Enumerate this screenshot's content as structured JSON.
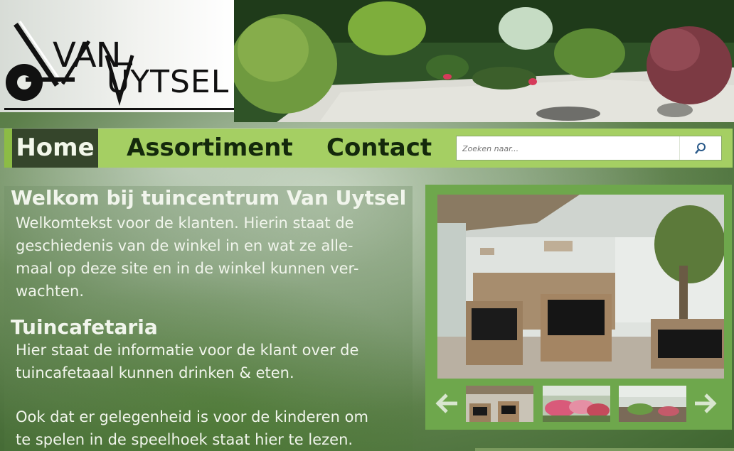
{
  "logo": {
    "line1": "VAN",
    "line2": "UYTSEL"
  },
  "nav": {
    "items": [
      {
        "label": "Home"
      },
      {
        "label": "Assortiment"
      },
      {
        "label": "Contact"
      }
    ],
    "search": {
      "placeholder": "Zoeken naar..."
    }
  },
  "main": {
    "title": "Welkom bij tuincentrum Van Uytsel",
    "intro": "Welkomtekst voor de klanten. Hierin staat de geschiedenis van de winkel in en wat ze allemaal op deze site en in de winkel kunnen verwachten.",
    "intro_lines": [
      "Welkomtekst voor de klanten. Hierin staat de",
      "geschiedenis van de winkel in en wat ze alle-",
      "maal op deze site en in de winkel kunnen ver-",
      "wachten."
    ],
    "section_title": "Tuincafetaria",
    "section_lines": [
      "Hier staat de informatie voor de klant over de",
      "tuincafetaaal kunnen drinken & eten."
    ],
    "extra_lines": [
      "Ook dat er gelegenheid is voor de kinderen om",
      "te spelen in de speelhoek staat hier te lezen."
    ]
  },
  "slider": {
    "prev_icon": "arrow-left-icon",
    "next_icon": "arrow-right-icon",
    "thumbnail_count": 3
  },
  "colors": {
    "nav_bg": "#a5cf63",
    "nav_active": "#35452b",
    "slider_bg": "#6ea74c",
    "text_light": "#f1f5ec"
  }
}
